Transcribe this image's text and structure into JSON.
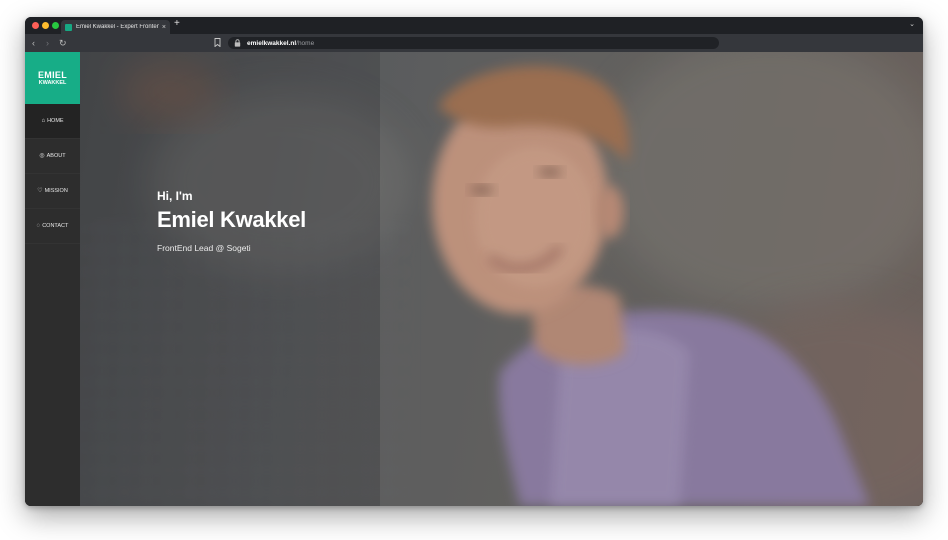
{
  "browser": {
    "tab_title": "Emiel Kwakkel - Expert Frontend",
    "tab_close": "×",
    "new_tab": "+",
    "url_host": "emielkwakkel.nl",
    "url_path": "/home",
    "back_icon": "‹",
    "forward_icon": "›",
    "reload_icon": "↻",
    "menu_icon": "⌄"
  },
  "sidebar": {
    "logo_line1": "EMIEL",
    "logo_line2": "KWAKKEL",
    "items": [
      {
        "icon": "⌂",
        "label": "HOME"
      },
      {
        "icon": "◎",
        "label": "ABOUT"
      },
      {
        "icon": "♡",
        "label": "MISSION"
      },
      {
        "icon": "◌",
        "label": "CONTACT"
      }
    ]
  },
  "hero": {
    "greeting": "Hi, I'm",
    "name": "Emiel Kwakkel",
    "role": "FrontEnd Lead @ Sogeti"
  },
  "colors": {
    "accent": "#17ad87",
    "sidebar": "#2d2d2d"
  }
}
